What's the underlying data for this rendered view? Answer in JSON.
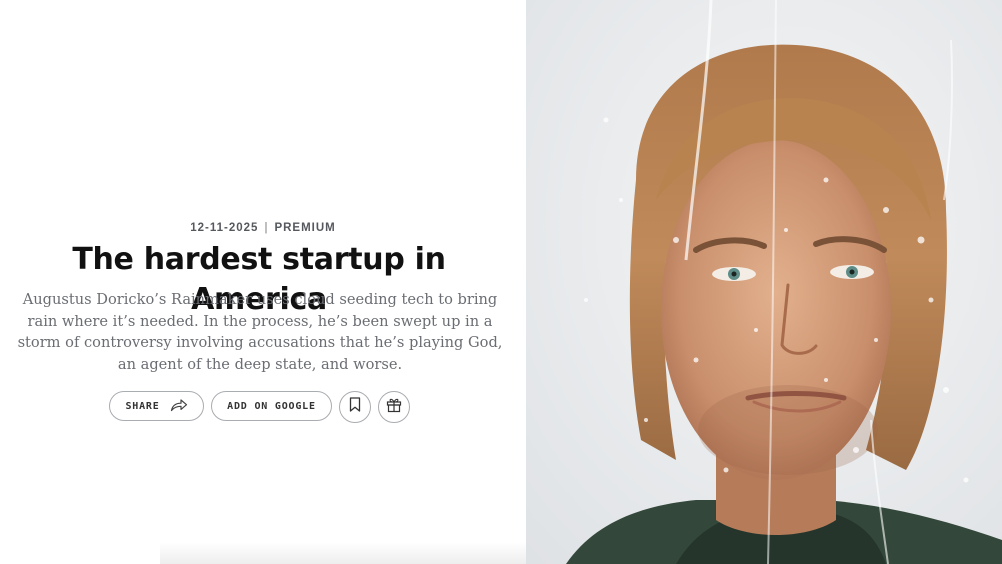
{
  "article": {
    "date": "12-11-2025",
    "separator": "|",
    "tier": "PREMIUM",
    "headline": "The hardest startup in America",
    "dek": "Augustus Doricko’s Rainmaker uses cloud seeding tech to bring rain where it’s needed. In the process, he’s been swept up in a storm of controversy involving accusations that he’s playing God, an agent of the deep state, and worse."
  },
  "actions": {
    "share_label": "SHARE",
    "share_icon": "share-arrow-icon",
    "google_label": "ADD ON GOOGLE",
    "bookmark_icon": "bookmark-icon",
    "gift_icon": "gift-icon"
  },
  "colors": {
    "headline": "#111111",
    "dek": "#6a6d72",
    "meta": "#55585d",
    "pill_border": "#a9acb0",
    "photo_background": "#eceef0"
  }
}
